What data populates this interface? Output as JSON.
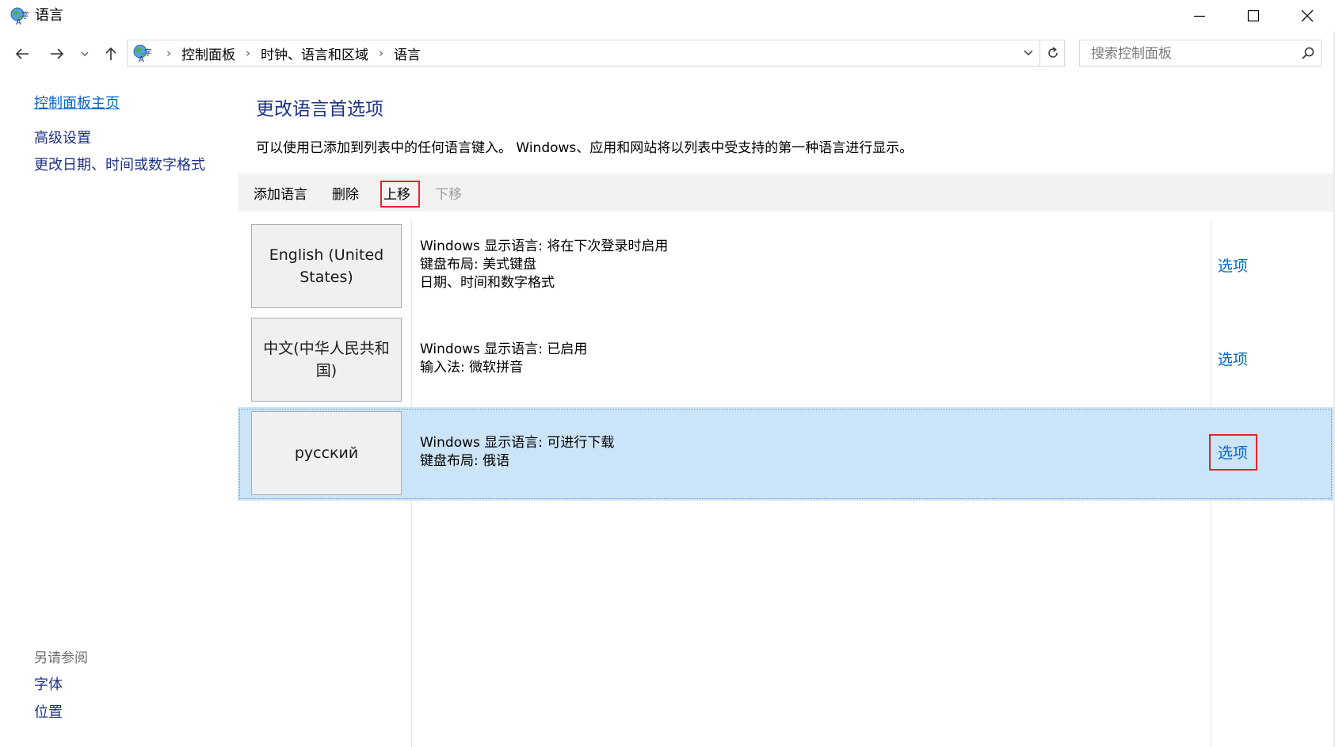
{
  "window": {
    "title": "语言",
    "icon": "globe-language-icon"
  },
  "address_bar": {
    "breadcrumbs": [
      "控制面板",
      "时钟、语言和区域",
      "语言"
    ],
    "search_placeholder": "搜索控制面板"
  },
  "sidebar": {
    "home_link": "控制面板主页",
    "links": [
      "高级设置",
      "更改日期、时间或数字格式"
    ],
    "see_also_heading": "另请参阅",
    "see_also_links": [
      "字体",
      "位置"
    ]
  },
  "main": {
    "heading": "更改语言首选项",
    "description": "可以使用已添加到列表中的任何语言键入。 Windows、应用和网站将以列表中受支持的第一种语言进行显示。",
    "toolbar": {
      "add_language": "添加语言",
      "remove": "删除",
      "move_up": "上移",
      "move_down": "下移"
    },
    "languages": [
      {
        "name": "English (United States)",
        "details": [
          "Windows 显示语言: 将在下次登录时启用",
          "键盘布局: 美式键盘",
          "日期、时间和数字格式"
        ],
        "options_label": "选项",
        "selected": false
      },
      {
        "name": "中文(中华人民共和国)",
        "details": [
          "Windows 显示语言: 已启用",
          "输入法: 微软拼音"
        ],
        "options_label": "选项",
        "selected": false
      },
      {
        "name": "русский",
        "details": [
          "Windows 显示语言: 可进行下载",
          "键盘布局: 俄语"
        ],
        "options_label": "选项",
        "selected": true
      }
    ]
  },
  "colors": {
    "link": "#0066cc",
    "heading": "#1e3287",
    "selection": "#cce4f7",
    "highlight_box": "#e0252a"
  }
}
